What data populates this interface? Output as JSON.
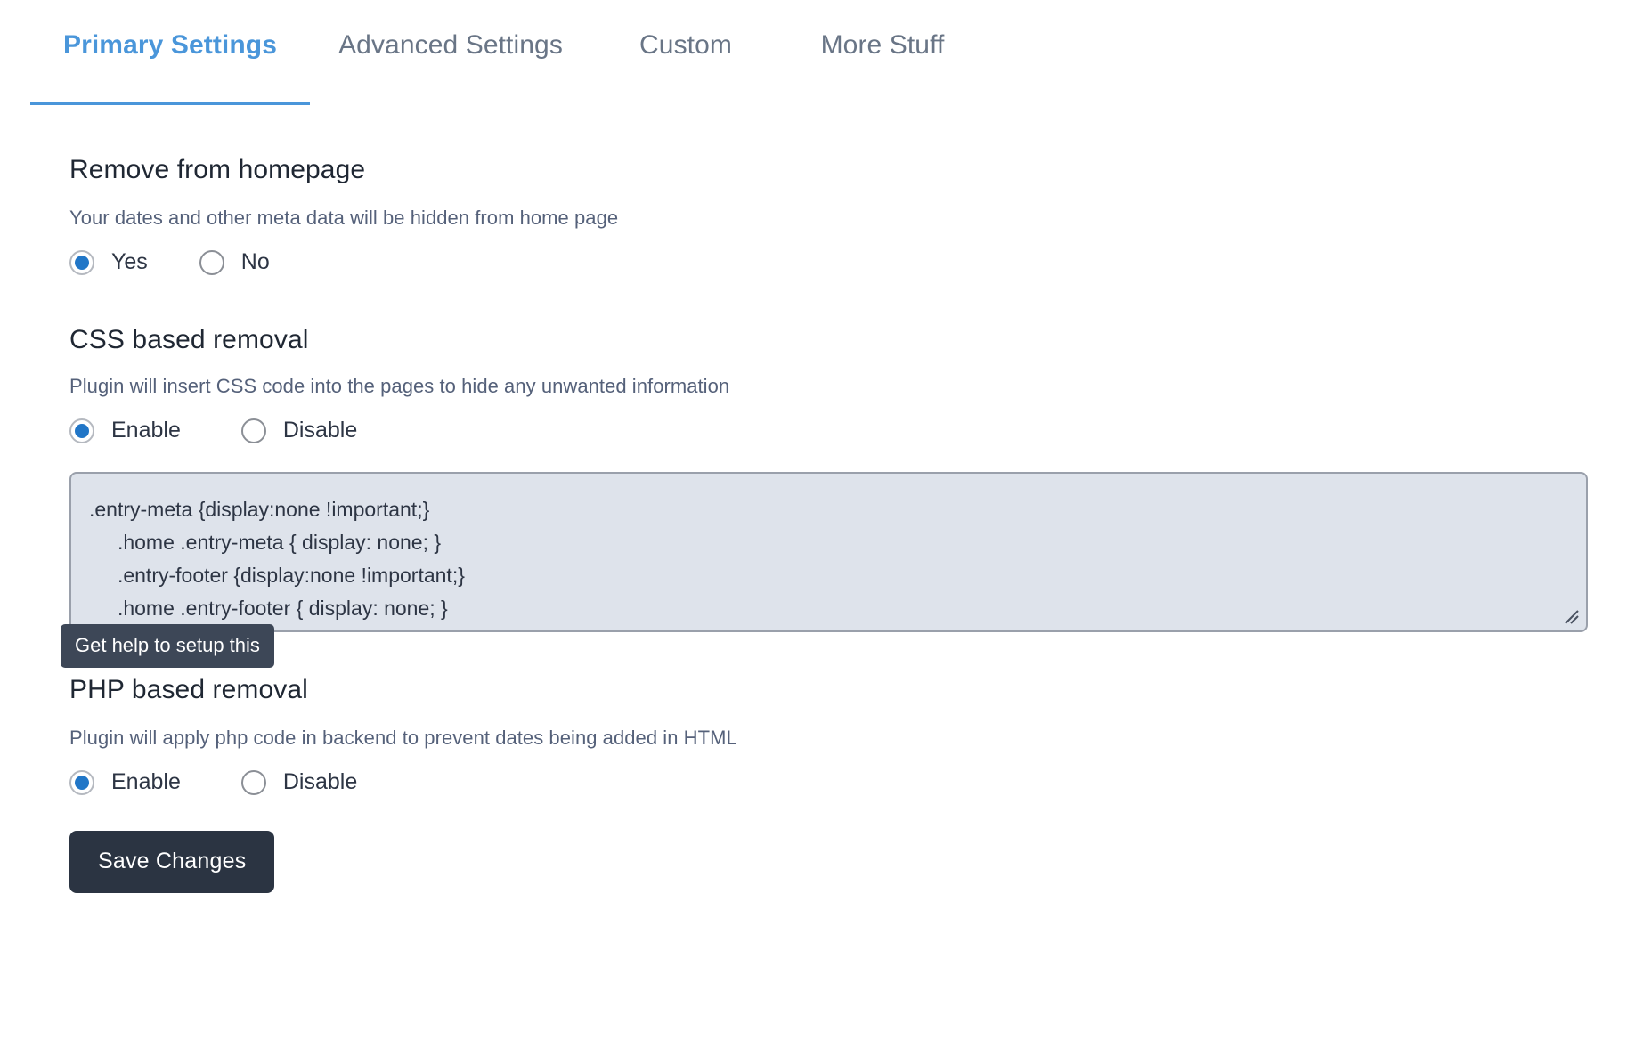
{
  "tabs": [
    {
      "label": "Primary Settings",
      "active": true
    },
    {
      "label": "Advanced Settings",
      "active": false
    },
    {
      "label": "Custom",
      "active": false
    },
    {
      "label": "More Stuff",
      "active": false
    }
  ],
  "sections": {
    "remove_from_homepage": {
      "title": "Remove from homepage",
      "description": "Your dates and other meta data will be hidden from home page",
      "options": [
        {
          "label": "Yes",
          "selected": true
        },
        {
          "label": "No",
          "selected": false
        }
      ]
    },
    "css_based_removal": {
      "title": "CSS based removal",
      "description": "Plugin will insert CSS code into the pages to hide any unwanted information",
      "options": [
        {
          "label": "Enable",
          "selected": true
        },
        {
          "label": "Disable",
          "selected": false
        }
      ],
      "code_value": ".entry-meta {display:none !important;}\n     .home .entry-meta { display: none; }\n     .entry-footer {display:none !important;}\n     .home .entry-footer { display: none; }",
      "code_placeholder": "",
      "help_tooltip": "Get help to setup this"
    },
    "php_based_removal": {
      "title": "PHP based removal",
      "description": "Plugin will apply php code in backend to prevent dates being added in HTML",
      "options": [
        {
          "label": "Enable",
          "selected": true
        },
        {
          "label": "Disable",
          "selected": false
        }
      ]
    }
  },
  "actions": {
    "save_label": "Save Changes"
  },
  "colors": {
    "accent": "#4a96da",
    "radio_selected": "#2176c7",
    "tab_inactive": "#697586",
    "tooltip_bg": "#3d4757",
    "button_bg": "#2b3442",
    "textarea_bg": "#dee3eb"
  }
}
